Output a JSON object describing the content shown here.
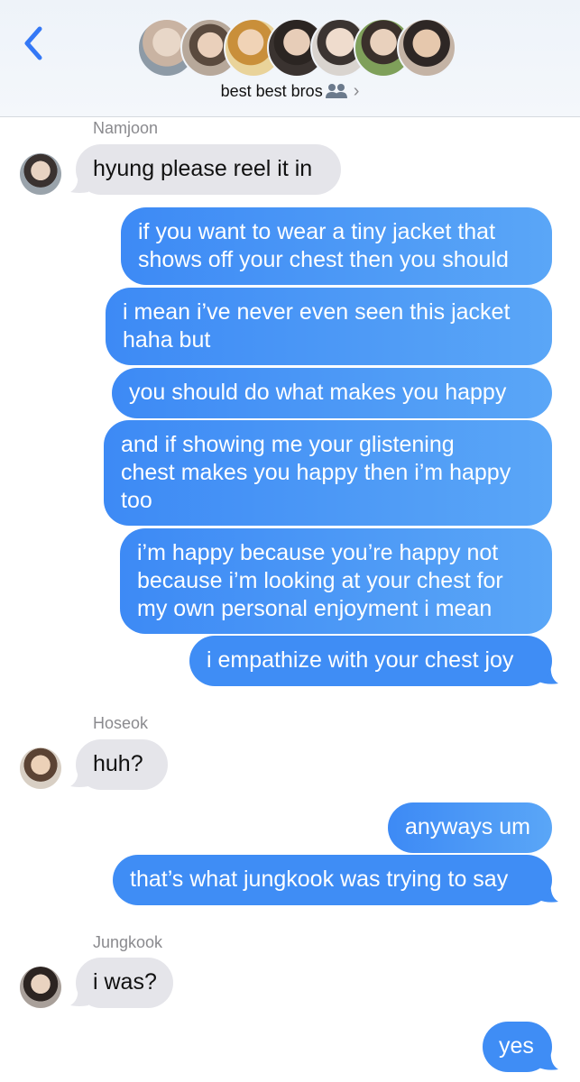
{
  "header": {
    "group_name": "best best bros",
    "group_icon": "two-people-icon",
    "chevron": "›",
    "avatar_count": 7
  },
  "messages": [
    {
      "from": "Namjoon",
      "text": "hyung please reel it in"
    },
    {
      "from": "me",
      "lines": [
        "if you want to wear a tiny jacket that",
        "shows off your chest then you should"
      ]
    },
    {
      "from": "me",
      "lines": [
        "i mean i’ve never even seen this jacket",
        "haha but"
      ]
    },
    {
      "from": "me",
      "lines": [
        "you should do what makes you happy"
      ]
    },
    {
      "from": "me",
      "lines": [
        "and if showing me your glistening",
        "chest makes you happy then i’m happy",
        "too"
      ]
    },
    {
      "from": "me",
      "lines": [
        "i’m happy because you’re happy not",
        "because i’m looking at your chest for",
        "my own personal enjoyment i mean"
      ]
    },
    {
      "from": "me",
      "lines": [
        "i empathize with your chest joy"
      ]
    },
    {
      "from": "Hoseok",
      "text": "huh?"
    },
    {
      "from": "me",
      "lines": [
        "anyways um"
      ]
    },
    {
      "from": "me",
      "lines": [
        "that’s what jungkook was trying to say"
      ]
    },
    {
      "from": "Jungkook",
      "text": "i was?"
    },
    {
      "from": "me",
      "lines": [
        "yes"
      ]
    }
  ],
  "colors": {
    "outgoing": "#3f8df5",
    "incoming": "#e5e5ea",
    "accent": "#3478f6"
  }
}
